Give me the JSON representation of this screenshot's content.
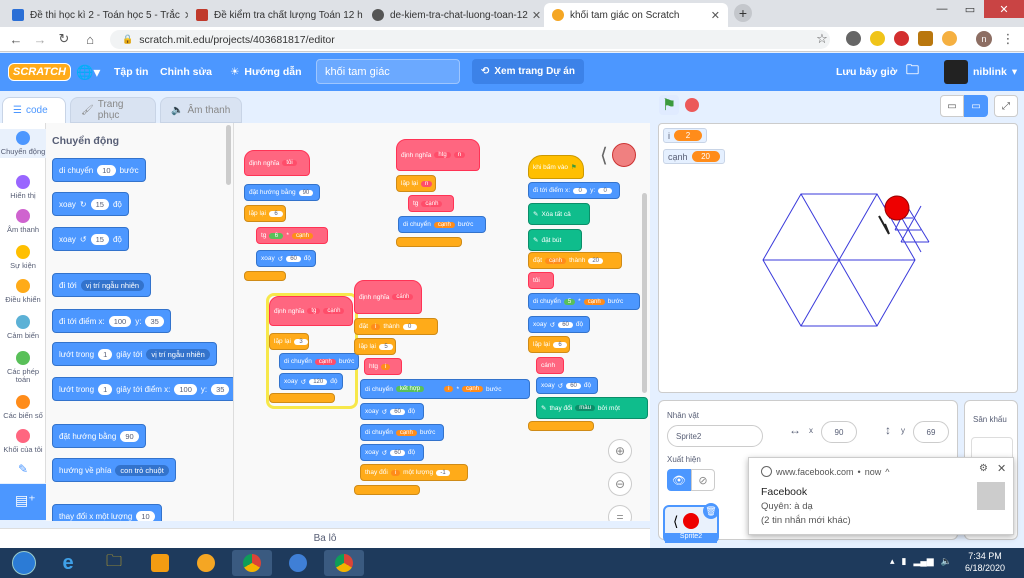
{
  "browser": {
    "tabs": [
      {
        "title": "Đề thi học kì 2 - Toán học 5 - Trắc",
        "favicon_color": "#2b6fd6"
      },
      {
        "title": "Đề kiểm tra chất lượng Toán 12 h",
        "favicon_color": "#c0392b"
      },
      {
        "title": "de-kiem-tra-chat-luong-toan-12",
        "favicon_color": "#555555"
      },
      {
        "title": "khối tam giác on Scratch",
        "favicon_color": "#f5a623"
      }
    ],
    "url": "scratch.mit.edu/projects/403681817/editor"
  },
  "menubar": {
    "logo": "SCRATCH",
    "file": "Tập tin",
    "edit": "Chỉnh sửa",
    "tutorials": "Hướng dẫn",
    "project_title": "khối tam giác",
    "see_project": "Xem trang Dự án",
    "save_now": "Lưu bây giờ",
    "username": "niblink"
  },
  "editor_tabs": {
    "code": "code",
    "costumes": "Trang phục",
    "sounds": "Âm thanh"
  },
  "categories": [
    {
      "label": "Chuyển động",
      "color": "#4c97ff"
    },
    {
      "label": "Hiển thị",
      "color": "#9966ff"
    },
    {
      "label": "Âm thanh",
      "color": "#cf63cf"
    },
    {
      "label": "Sự kiện",
      "color": "#ffbf00"
    },
    {
      "label": "Điều khiển",
      "color": "#ffab19"
    },
    {
      "label": "Cảm biến",
      "color": "#5cb1d6"
    },
    {
      "label": "Các phép toán",
      "color": "#59c059"
    },
    {
      "label": "Các biến số",
      "color": "#ff8c1a"
    },
    {
      "label": "Khối của tôi",
      "color": "#ff6680"
    }
  ],
  "palette": {
    "heading": "Chuyển động",
    "move": {
      "text": "di chuyển",
      "value": "10",
      "suffix": "bước"
    },
    "turn_right": {
      "text": "xoay",
      "value": "15",
      "suffix": "độ"
    },
    "turn_left": {
      "text": "xoay",
      "value": "15",
      "suffix": "độ"
    },
    "goto": {
      "text": "đi tới",
      "option": "vị trí ngẫu nhiên"
    },
    "goto_xy": {
      "text": "đi tới điểm x:",
      "x": "100",
      "ylabel": "y:",
      "y": "35"
    },
    "glide": {
      "text": "lướt trong",
      "value": "1",
      "mid": "giây tới",
      "option": "vị trí ngẫu nhiên"
    },
    "glide_xy": {
      "text": "lướt trong",
      "value": "1",
      "mid": "giây tới điểm x:",
      "x": "100",
      "ylabel": "y:",
      "y": "35"
    },
    "point": {
      "text": "đặt hướng bằng",
      "value": "90"
    },
    "point_towards": {
      "text": "hướng về phía",
      "option": "con trỏ chuột"
    },
    "change_x": {
      "text": "thay đổi x một lượng",
      "value": "10"
    }
  },
  "scripts": {
    "s1": {
      "define": "định nghĩa",
      "name": "tôi",
      "dir": "đặt hướng bằng",
      "dir_val": "90",
      "repeat": "lặp lại",
      "repeat_val": "6",
      "call": "tg",
      "call_val": "6",
      "call_var": "cạnh",
      "turn": "xoay",
      "turn_val": "60",
      "deg": "độ"
    },
    "s2": {
      "define": "định nghĩa",
      "name": "htg",
      "arg": "n",
      "repeat": "lặp lại",
      "repeat_var": "n",
      "call": "tg",
      "call_var": "cạnh",
      "move": "di chuyển",
      "move_var": "cạnh",
      "steps": "bước"
    },
    "s3": {
      "define": "định nghĩa",
      "name": "tg",
      "arg": "cạnh",
      "repeat": "lặp lại",
      "repeat_val": "3",
      "move": "di chuyển",
      "move_var": "cạnh",
      "steps": "bước",
      "turn": "xoay",
      "turn_val": "120",
      "deg": "độ"
    },
    "s4": {
      "define": "định nghĩa",
      "name": "cánh",
      "set": "đặt",
      "set_var": "i",
      "to": "thành",
      "set_val": "0",
      "repeat": "lặp lại",
      "repeat_val": "5",
      "call": "htg",
      "call_var": "i",
      "move": "di chuyển",
      "join": "kết hợp",
      "join_a": "",
      "join_var": "i",
      "join_var2": "cạnh",
      "steps": "bước",
      "turn1": "xoay",
      "turn1_val": "60",
      "deg": "độ",
      "move2": "di chuyển",
      "move2_var": "cạnh",
      "turn2": "xoay",
      "turn2_val": "60",
      "change": "thay đổi",
      "change_var": "i",
      "by": "một lượng",
      "change_val": "-1"
    },
    "s5": {
      "hat": "khi bấm vào",
      "goto": "đi tới điểm x:",
      "x": "0",
      "ylabel": "y:",
      "y": "0",
      "clear": "Xóa tất cả",
      "pendown": "đặt bút",
      "set": "đặt",
      "set_var": "cạnh",
      "to": "thành",
      "set_val": "20",
      "call": "tôi",
      "move": "di chuyển",
      "move_val": "5",
      "move_var": "cạnh",
      "steps": "bước",
      "turn": "xoay",
      "turn_val": "60",
      "deg": "độ",
      "repeat": "lặp lại",
      "repeat_val": "6",
      "call2": "cánh",
      "turn2": "xoay",
      "turn2_val": "60",
      "change": "thay đổi",
      "change_opt": "màu",
      "change_suffix": "bởi một"
    }
  },
  "stage": {
    "monitors": [
      {
        "name": "i",
        "value": "2"
      },
      {
        "name": "cạnh",
        "value": "20"
      }
    ]
  },
  "sprite_info": {
    "sprite_label": "Nhân vật",
    "sprite_name": "Sprite2",
    "x_label": "x",
    "x": "90",
    "y_label": "y",
    "y": "69",
    "show_label": "Xuất hiện",
    "thumb_label": "Sprite2"
  },
  "backdrop": {
    "label": "Sân khấu"
  },
  "notification": {
    "source": "www.facebook.com",
    "time": "now",
    "title": "Facebook",
    "line1": "Quyên: à dạ",
    "line2": "(2 tin nhắn mới khác)"
  },
  "backpack": "Ba lô",
  "taskbar": {
    "time": "7:34 PM",
    "date": "6/18/2020"
  }
}
